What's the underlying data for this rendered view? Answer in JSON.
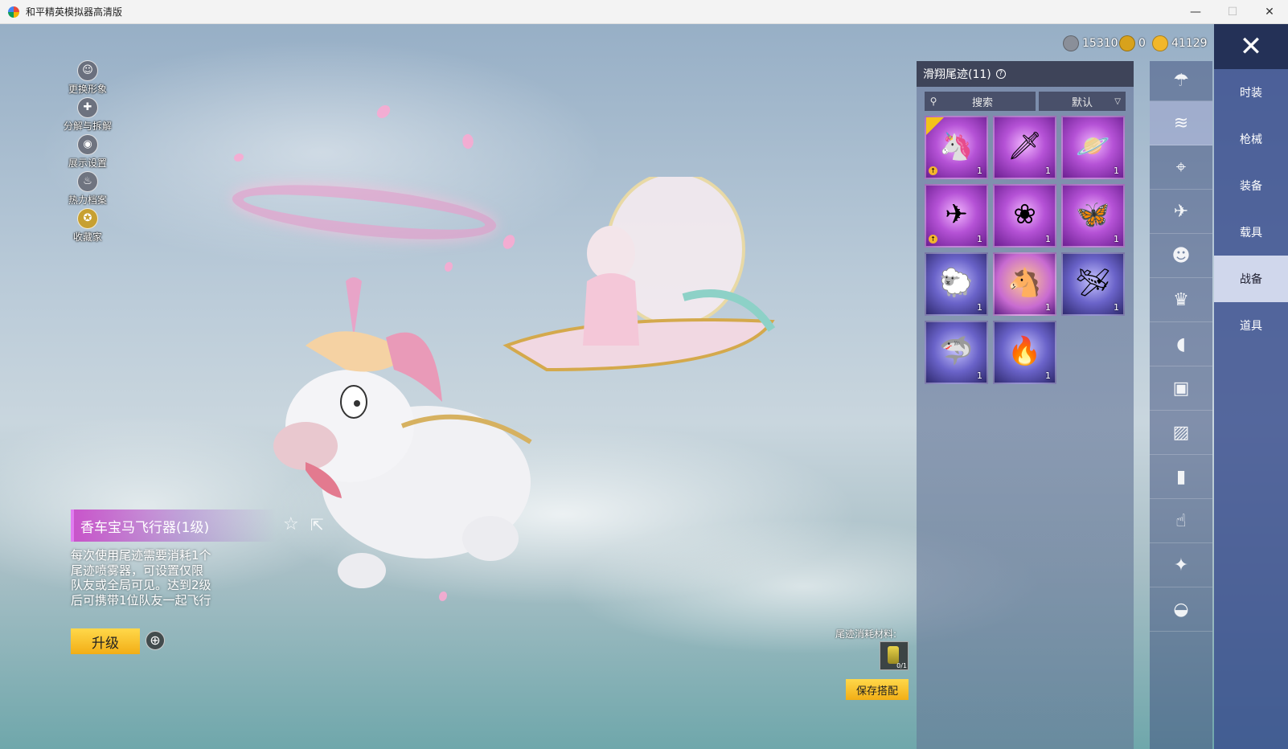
{
  "window": {
    "title": "和平精英模拟器高清版",
    "minimize": "—",
    "maximize": "☐",
    "close": "✕"
  },
  "left_menu": [
    {
      "icon": "avatar-icon",
      "label": "更换形象"
    },
    {
      "icon": "puzzle-icon",
      "label": "分解与拆解"
    },
    {
      "icon": "eye-icon",
      "label": "展示设置"
    },
    {
      "icon": "flame-icon",
      "label": "热力档案"
    },
    {
      "icon": "medal-icon",
      "label": "收藏家"
    }
  ],
  "currency": [
    {
      "icon": "gray-coin-icon",
      "value": "15310",
      "color": "#8a8f99"
    },
    {
      "icon": "gold-token-icon",
      "value": "0",
      "color": "#d8a21c"
    },
    {
      "icon": "gold-coin-icon",
      "value": "41129",
      "color": "#f2b72a"
    }
  ],
  "item": {
    "name": "香车宝马飞行器(1级)",
    "description": "每次使用尾迹需要消耗1个尾迹喷雾器，可设置仅限队友或全局可见。达到2级后可携带1位队友一起飞行",
    "upgrade_label": "升级"
  },
  "panel": {
    "title": "滑翔尾迹(11)",
    "search_placeholder": "搜索",
    "sort_value": "默认",
    "items": [
      {
        "icon": "unicorn-carriage-icon",
        "count": "1",
        "equipped": true,
        "badge": true,
        "rarity": "purple"
      },
      {
        "icon": "heart-blade-icon",
        "count": "1",
        "equipped": false,
        "badge": false,
        "rarity": "purple"
      },
      {
        "icon": "pink-planet-icon",
        "count": "1",
        "equipped": false,
        "badge": false,
        "rarity": "purple"
      },
      {
        "icon": "red-orb-jet-icon",
        "count": "1",
        "equipped": false,
        "badge": true,
        "rarity": "purple"
      },
      {
        "icon": "crystal-flower-icon",
        "count": "1",
        "equipped": false,
        "badge": false,
        "rarity": "purple"
      },
      {
        "icon": "butterfly-icon",
        "count": "1",
        "equipped": false,
        "badge": false,
        "rarity": "purple"
      },
      {
        "icon": "alpaca-icon",
        "count": "1",
        "equipped": false,
        "badge": false,
        "rarity": "blue"
      },
      {
        "icon": "toy-horse-icon",
        "count": "1",
        "equipped": false,
        "badge": false,
        "rarity": "purple"
      },
      {
        "icon": "jet-wing-icon",
        "count": "1",
        "equipped": false,
        "badge": false,
        "rarity": "blue"
      },
      {
        "icon": "shark-icon",
        "count": "1",
        "equipped": false,
        "badge": false,
        "rarity": "blue"
      },
      {
        "icon": "flame-trail-icon",
        "count": "1",
        "equipped": false,
        "badge": false,
        "rarity": "blue"
      }
    ]
  },
  "material": {
    "label": "尾迹消耗材料:",
    "count": "0/1"
  },
  "save_label": "保存搭配",
  "subcategories": [
    {
      "icon": "parachute-icon",
      "active": false
    },
    {
      "icon": "glide-trail-icon",
      "active": true
    },
    {
      "icon": "drone-icon",
      "active": false
    },
    {
      "icon": "plane-icon",
      "active": false
    },
    {
      "icon": "emote-face-icon",
      "active": false
    },
    {
      "icon": "companion-icon",
      "active": false
    },
    {
      "icon": "voice-icon",
      "active": false
    },
    {
      "icon": "chest-icon",
      "active": false
    },
    {
      "icon": "photo-frame-icon",
      "active": false
    },
    {
      "icon": "spray-icon",
      "active": false
    },
    {
      "icon": "tap-gesture-icon",
      "active": false
    },
    {
      "icon": "magic-wand-icon",
      "active": false
    },
    {
      "icon": "roast-chicken-icon",
      "active": false
    }
  ],
  "categories": [
    {
      "label": "时装",
      "active": false
    },
    {
      "label": "枪械",
      "active": false
    },
    {
      "label": "装备",
      "active": false
    },
    {
      "label": "载具",
      "active": false
    },
    {
      "label": "战备",
      "active": true
    },
    {
      "label": "道具",
      "active": false
    }
  ]
}
